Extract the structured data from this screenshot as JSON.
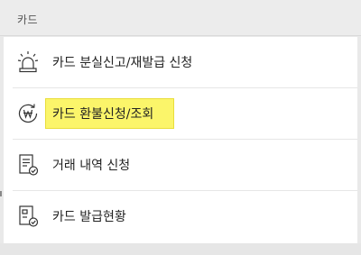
{
  "section": {
    "title": "카드"
  },
  "items": [
    {
      "label": "카드 분실신고/재발급 신청",
      "icon": "siren-icon"
    },
    {
      "label": "카드 환불신청/조회",
      "icon": "won-refund-icon",
      "highlighted": true
    },
    {
      "label": "거래 내역 신청",
      "icon": "document-check-icon"
    },
    {
      "label": "카드 발급현황",
      "icon": "card-status-icon"
    }
  ],
  "colors": {
    "highlight": "#fbf56a",
    "text": "#222222",
    "background": "#e9e9e9"
  }
}
